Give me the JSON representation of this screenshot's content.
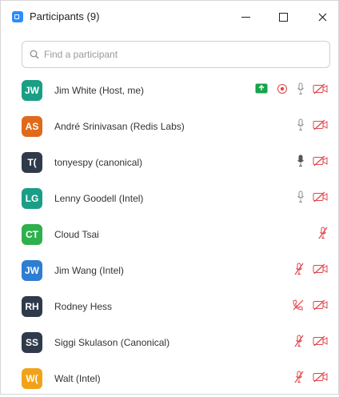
{
  "window": {
    "title": "Participants (9)",
    "app_icon": "zoom-icon",
    "controls": [
      "minimize-icon",
      "maximize-icon",
      "close-icon"
    ]
  },
  "search": {
    "placeholder": "Find a participant",
    "icon": "search-icon"
  },
  "colors": {
    "avatar_teal": "#1a9e86",
    "avatar_orange": "#e06a1b",
    "avatar_dark": "#2f3a4a",
    "avatar_green": "#2eb04c",
    "avatar_blue": "#2d7dd2",
    "avatar_gold": "#f0a31a",
    "muted_red": "#e0454a",
    "mic_gray": "#8f8f8f",
    "share_green": "#17a34a"
  },
  "participants": [
    {
      "initials": "JW",
      "name": "Jim White (Host, me)",
      "avatar_color": "#1a9e86",
      "icons": [
        "screen-share-icon",
        "record-icon",
        "mic-icon",
        "video-off-icon"
      ]
    },
    {
      "initials": "AS",
      "name": "André Srinivasan (Redis Labs)",
      "avatar_color": "#e06a1b",
      "icons": [
        "mic-icon",
        "video-off-icon"
      ]
    },
    {
      "initials": "T(",
      "name": "tonyespy (canonical)",
      "avatar_color": "#2f3a4a",
      "icons": [
        "mic-active-icon",
        "video-off-icon"
      ]
    },
    {
      "initials": "LG",
      "name": "Lenny Goodell (Intel)",
      "avatar_color": "#1a9e86",
      "icons": [
        "mic-icon",
        "video-off-icon"
      ]
    },
    {
      "initials": "CT",
      "name": "Cloud Tsai",
      "avatar_color": "#2eb04c",
      "icons": [
        "mic-muted-icon"
      ]
    },
    {
      "initials": "JW",
      "name": "Jim Wang (Intel)",
      "avatar_color": "#2d7dd2",
      "icons": [
        "mic-muted-icon",
        "video-off-icon"
      ]
    },
    {
      "initials": "RH",
      "name": "Rodney Hess",
      "avatar_color": "#2f3a4a",
      "icons": [
        "phone-muted-icon",
        "video-off-icon"
      ]
    },
    {
      "initials": "SS",
      "name": "Siggi Skulason (Canonical)",
      "avatar_color": "#2f3a4a",
      "icons": [
        "mic-muted-icon",
        "video-off-icon"
      ]
    },
    {
      "initials": "W(",
      "name": "Walt (Intel)",
      "avatar_color": "#f0a31a",
      "icons": [
        "mic-muted-icon",
        "video-off-icon"
      ]
    }
  ]
}
